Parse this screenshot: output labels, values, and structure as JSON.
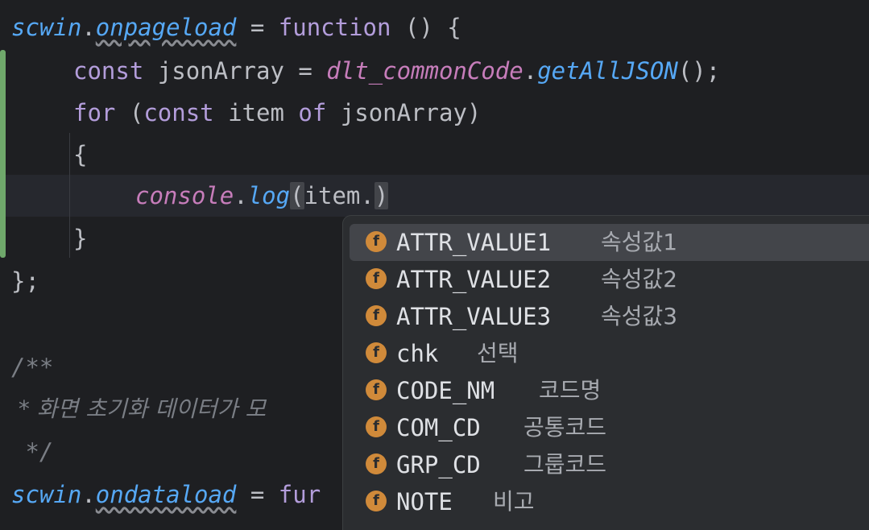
{
  "code": {
    "l1": {
      "obj": "scwin",
      "dot": ".",
      "prop": "onpageload",
      "eq": " = ",
      "kw": "function",
      "rest": " () {"
    },
    "l2": {
      "kw": "const",
      "var": " jsonArray = ",
      "obj": "dlt_commonCode",
      "dot": ".",
      "fn": "getAllJSON",
      "rest": "();"
    },
    "l3": {
      "kw1": "for",
      "p1": " (",
      "kw2": "const",
      "mid": " item ",
      "kw3": "of",
      "rest": " jsonArray)"
    },
    "l4": "{",
    "l5": {
      "obj": "console",
      "dot": ".",
      "fn": "log",
      "paren": "(",
      "rest": "item.",
      "close": ")"
    },
    "l6": "}",
    "l7": "};",
    "l9": "/**",
    "l10": " * 화면 초기화 데이터가 모",
    "l11": " */",
    "l12": {
      "obj": "scwin",
      "dot": ".",
      "prop": "ondataload",
      "eq": " = ",
      "kw": "fur"
    }
  },
  "autocomplete": {
    "icon_letter": "f",
    "items": [
      {
        "name": "ATTR_VALUE1",
        "type": "속성값1"
      },
      {
        "name": "ATTR_VALUE2",
        "type": "속성값2"
      },
      {
        "name": "ATTR_VALUE3",
        "type": "속성값3"
      },
      {
        "name": "chk",
        "type": "선택"
      },
      {
        "name": "CODE_NM",
        "type": "코드명"
      },
      {
        "name": "COM_CD",
        "type": "공통코드"
      },
      {
        "name": "GRP_CD",
        "type": "그룹코드"
      },
      {
        "name": "NOTE",
        "type": "비고"
      }
    ]
  }
}
